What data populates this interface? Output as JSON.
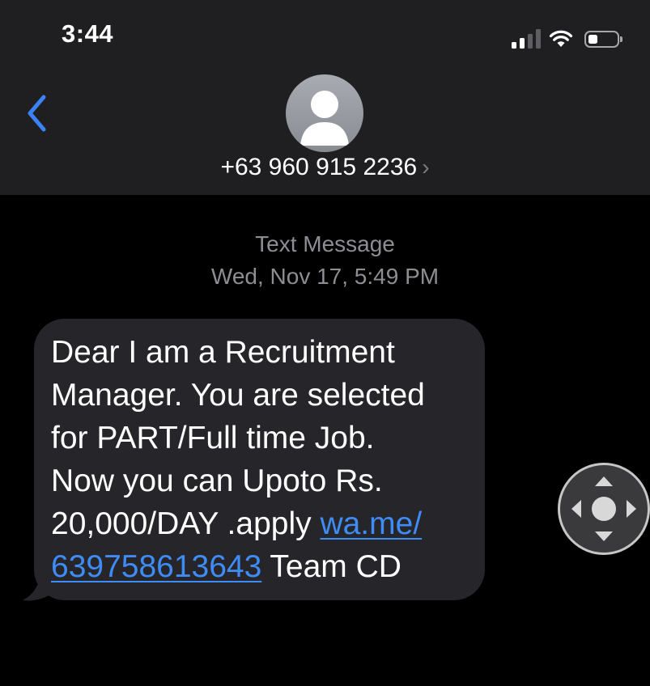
{
  "status_bar": {
    "time": "3:44"
  },
  "header": {
    "back_icon": "chevron-left-icon",
    "contact": "+63 960 915 2236",
    "contact_chevron": "›"
  },
  "conversation": {
    "service": "Text Message",
    "timestamp": "Wed, Nov 17, 5:49 PM"
  },
  "message": {
    "text_before_link": "Dear I am a Recruitment\nManager. You are selected\nfor PART/Full time Job.\nNow you can Upoto Rs.\n20,000/DAY .apply ",
    "link_line1": "wa.me/",
    "link_line2": "639758613643",
    "text_after_link": " Team CD"
  },
  "colors": {
    "header_bg": "#1f1f21",
    "bubble_bg": "#26252a",
    "link": "#3f8cf6",
    "meta_text": "#8d8d92",
    "back_arrow": "#3b82f6"
  }
}
